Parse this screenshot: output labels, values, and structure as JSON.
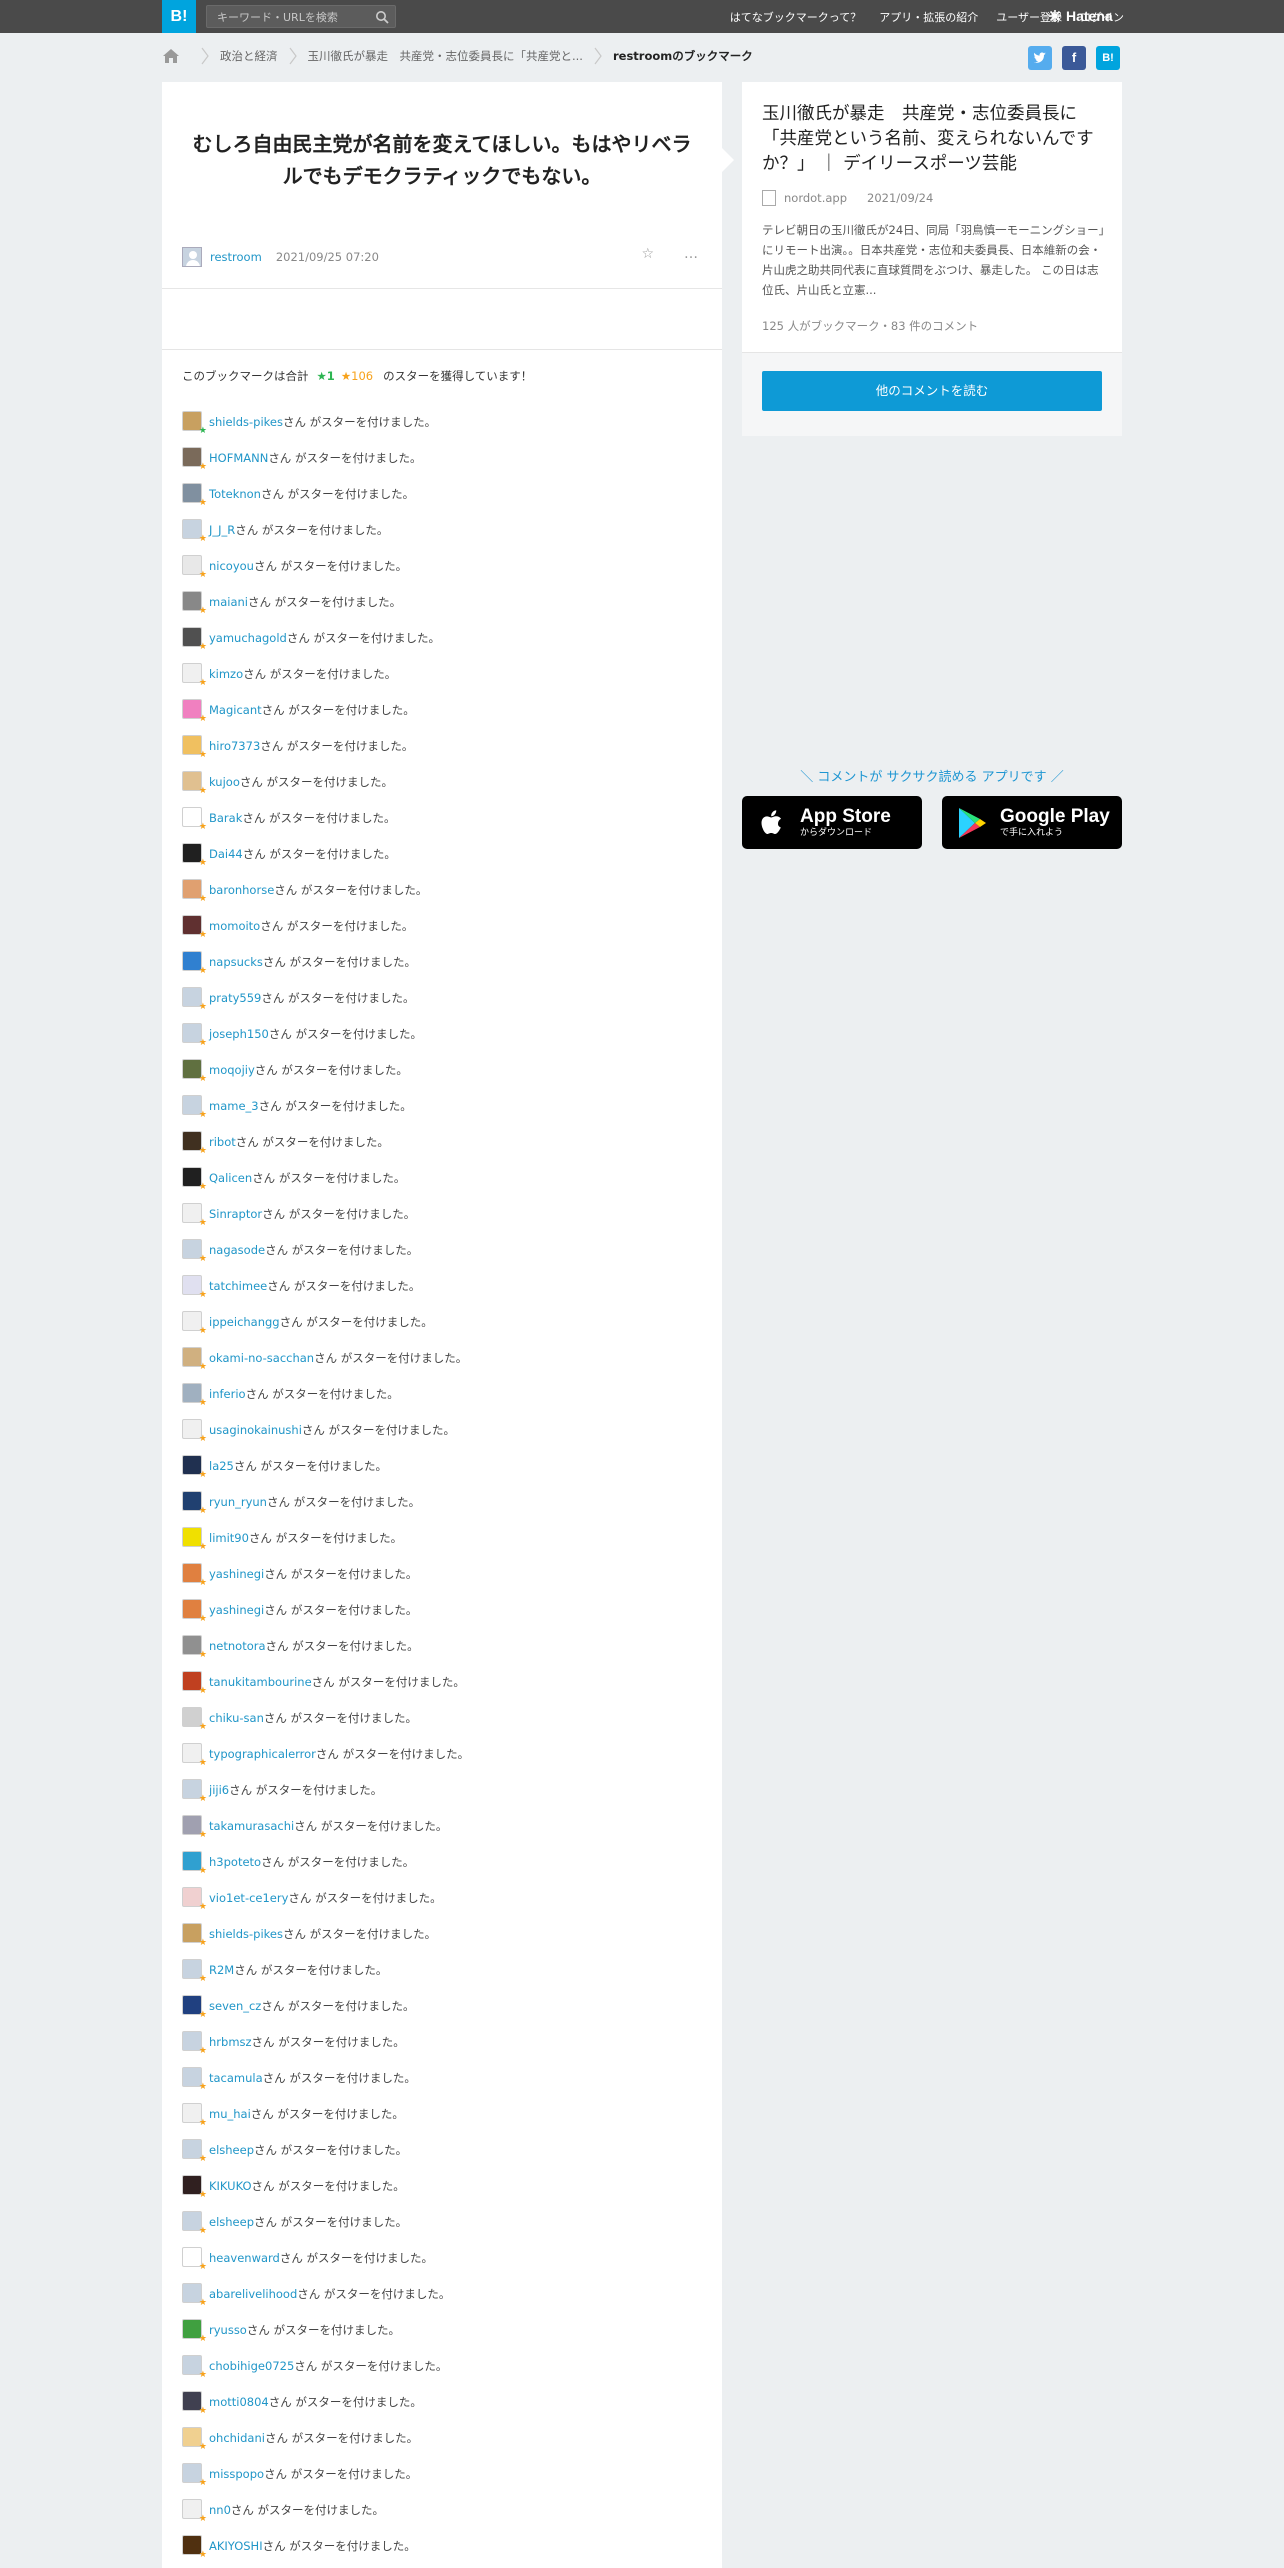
{
  "header": {
    "logo": "B!",
    "search_placeholder": "キーワード・URLを検索",
    "nav": [
      "はてなブックマークって？",
      "アプリ・拡張の紹介",
      "ユーザー登録",
      "ログイン"
    ],
    "brand": "Hatena"
  },
  "breadcrumb": [
    {
      "label": "政治と経済"
    },
    {
      "label": "玉川徹氏が暴走　共産党・志位委員長に「共産党と..."
    },
    {
      "label": "restroomのブックマーク"
    }
  ],
  "share": {
    "twitter": "t",
    "facebook": "f",
    "hatena": "B!"
  },
  "colors": {
    "accent": "#00a4de",
    "link": "#2196c8",
    "star_green": "#2db552",
    "star_orange": "#f7a21b"
  },
  "bookmark": {
    "comment": "むしろ自由民主党が名前を変えてほしい。もはやリベラルでもデモクラティックでもない。",
    "user": "restroom",
    "timestamp": "2021/09/25 07:20",
    "star_icon": "☆",
    "more_icon": "…"
  },
  "stars_summary": {
    "prefix": "このブックマークは合計",
    "green": "★1",
    "orange": "★106",
    "suffix": "のスターを獲得しています！"
  },
  "star_suffix": "さん がスターを付けました。",
  "star_users": [
    {
      "name": "shields-pikes",
      "color": "#c8a060",
      "green": true
    },
    {
      "name": "HOFMANN",
      "color": "#7a6a5a"
    },
    {
      "name": "Toteknon",
      "color": "#8090a0"
    },
    {
      "name": "J_J_R",
      "color": "#c7d3e0"
    },
    {
      "name": "nicoyou",
      "color": "#e8e8e8"
    },
    {
      "name": "maiani",
      "color": "#888888"
    },
    {
      "name": "yamuchagold",
      "color": "#505050"
    },
    {
      "name": "kimzo",
      "color": "#f0f0f0"
    },
    {
      "name": "Magicant",
      "color": "#f080c0"
    },
    {
      "name": "hiro7373",
      "color": "#f0c060"
    },
    {
      "name": "kujoo",
      "color": "#e0c090"
    },
    {
      "name": "Barak",
      "color": "#ffffff"
    },
    {
      "name": "Dai44",
      "color": "#202020"
    },
    {
      "name": "baronhorse",
      "color": "#e0a070"
    },
    {
      "name": "momoito",
      "color": "#603030"
    },
    {
      "name": "napsucks",
      "color": "#3080d0"
    },
    {
      "name": "praty559",
      "color": "#c7d3e0"
    },
    {
      "name": "joseph150",
      "color": "#c7d3e0"
    },
    {
      "name": "moqojiy",
      "color": "#607040"
    },
    {
      "name": "mame_3",
      "color": "#c7d3e0"
    },
    {
      "name": "ribot",
      "color": "#403020"
    },
    {
      "name": "Qalicen",
      "color": "#202020"
    },
    {
      "name": "Sinraptor",
      "color": "#f0f0f0"
    },
    {
      "name": "nagasode",
      "color": "#c7d3e0"
    },
    {
      "name": "tatchimee",
      "color": "#e0e0f0"
    },
    {
      "name": "ippeichangg",
      "color": "#f0f0f0"
    },
    {
      "name": "okami-no-sacchan",
      "color": "#d0b080"
    },
    {
      "name": "inferio",
      "color": "#a0b0c0"
    },
    {
      "name": "usaginokainushi",
      "color": "#f0f0f0"
    },
    {
      "name": "la25",
      "color": "#203050"
    },
    {
      "name": "ryun_ryun",
      "color": "#204070"
    },
    {
      "name": "limit90",
      "color": "#f0e000"
    },
    {
      "name": "yashinegi",
      "color": "#e08040"
    },
    {
      "name": "yashinegi",
      "color": "#e08040"
    },
    {
      "name": "netnotora",
      "color": "#909090"
    },
    {
      "name": "tanukitambourine",
      "color": "#c04020"
    },
    {
      "name": "chiku-san",
      "color": "#d0d0d0"
    },
    {
      "name": "typographicalerror",
      "color": "#f0f0f0"
    },
    {
      "name": "jiji6",
      "color": "#c7d3e0"
    },
    {
      "name": "takamurasachi",
      "color": "#a0a0b0"
    },
    {
      "name": "h3poteto",
      "color": "#30a0d0"
    },
    {
      "name": "vio1et-ce1ery",
      "color": "#f0d0d0"
    },
    {
      "name": "shields-pikes",
      "color": "#c8a060"
    },
    {
      "name": "R2M",
      "color": "#c7d3e0"
    },
    {
      "name": "seven_cz",
      "color": "#204080"
    },
    {
      "name": "hrbmsz",
      "color": "#c7d3e0"
    },
    {
      "name": "tacamula",
      "color": "#c7d3e0"
    },
    {
      "name": "mu_hai",
      "color": "#f0f0f0"
    },
    {
      "name": "elsheep",
      "color": "#c7d3e0"
    },
    {
      "name": "KIKUKO",
      "color": "#302020"
    },
    {
      "name": "elsheep",
      "color": "#c7d3e0"
    },
    {
      "name": "heavenward",
      "color": "#ffffff"
    },
    {
      "name": "abarelivelihood",
      "color": "#c7d3e0"
    },
    {
      "name": "ryusso",
      "color": "#40a040"
    },
    {
      "name": "chobihige0725",
      "color": "#c7d3e0"
    },
    {
      "name": "motti0804",
      "color": "#404050"
    },
    {
      "name": "ohchidani",
      "color": "#f0d090"
    },
    {
      "name": "misspopo",
      "color": "#c7d3e0"
    },
    {
      "name": "nn0",
      "color": "#f0f0f0"
    },
    {
      "name": "AKIYOSHI",
      "color": "#503010"
    }
  ],
  "entry": {
    "title": "玉川徹氏が暴走　共産党・志位委員長に「共産党という名前、変えられないんですか？」 ｜ デイリースポーツ芸能",
    "site": "nordot.app",
    "date": "2021/09/24",
    "description": "テレビ朝日の玉川徹氏が24日、同局「羽鳥慎一モーニングショー」にリモート出演。。日本共産党・志位和夫委員長、日本維新の会・片山虎之助共同代表に直球質問をぶつけ、暴走した。 この日は志位氏、片山氏と立憲...",
    "count": "125 人がブックマーク・83 件のコメント",
    "read_more": "他のコメントを読む"
  },
  "app_promo": {
    "text": "＼ コメントが サクサク読める アプリです ／",
    "appstore_big": "App Store",
    "appstore_small": "からダウンロード",
    "googleplay_big": "Google Play",
    "googleplay_small": "で手に入れよう"
  }
}
